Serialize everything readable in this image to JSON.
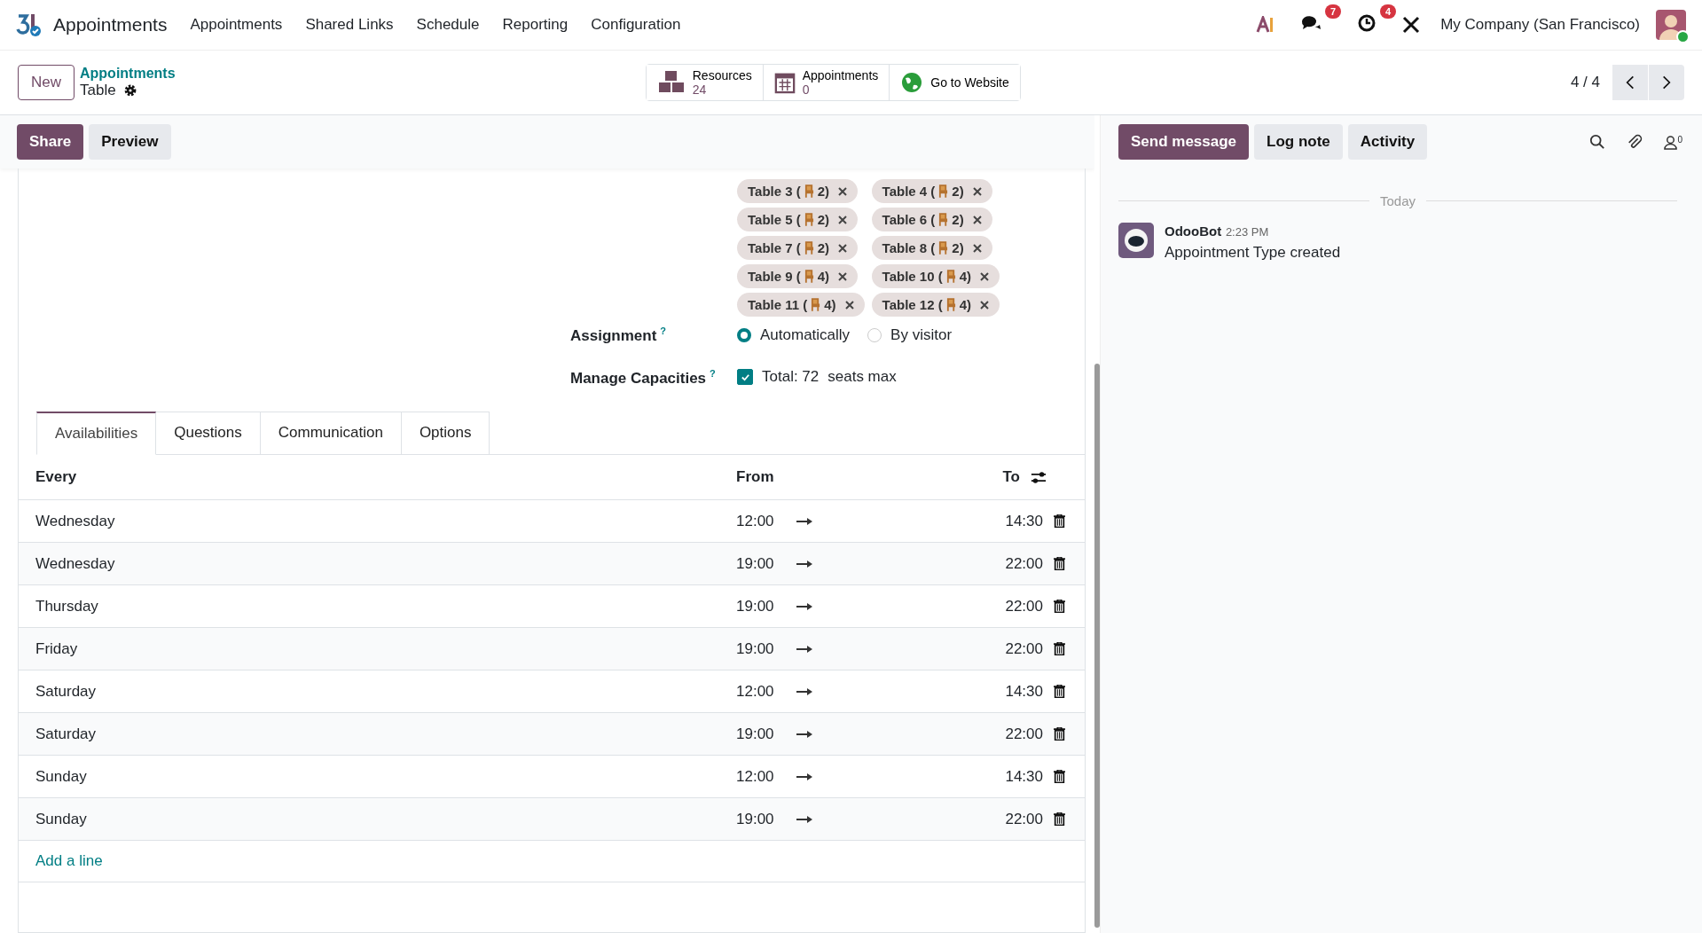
{
  "navbar": {
    "app_name": "Appointments",
    "menu": [
      "Appointments",
      "Shared Links",
      "Schedule",
      "Reporting",
      "Configuration"
    ],
    "chat_badge": "7",
    "activity_badge": "4",
    "company": "My Company (San Francisco)"
  },
  "control_panel": {
    "new_button": "New",
    "breadcrumb": "Appointments",
    "record_title": "Table",
    "smart_buttons": [
      {
        "kind": "resources",
        "label": "Resources",
        "value": "24"
      },
      {
        "kind": "calendar",
        "label": "Appointments",
        "value": "0"
      },
      {
        "kind": "website",
        "label": "Go to Website"
      }
    ],
    "pager": "4 / 4"
  },
  "form_actions": [
    {
      "label": "Share",
      "primary": true
    },
    {
      "label": "Preview",
      "primary": false
    }
  ],
  "resource_tags": [
    {
      "before": "Table 3 (",
      "after": "2)"
    },
    {
      "before": "Table 4 (",
      "after": "2)"
    },
    {
      "before": "Table 5 (",
      "after": "2)"
    },
    {
      "before": "Table 6 (",
      "after": "2)"
    },
    {
      "before": "Table 7 (",
      "after": "2)"
    },
    {
      "before": "Table 8 (",
      "after": "2)"
    },
    {
      "before": "Table 9 (",
      "after": "4)"
    },
    {
      "before": "Table 10 (",
      "after": "4)"
    },
    {
      "before": "Table 11 (",
      "after": "4)"
    },
    {
      "before": "Table 12 (",
      "after": "4)"
    }
  ],
  "assignment": {
    "label": "Assignment",
    "help": "?",
    "options": [
      {
        "label": "Automatically",
        "selected": true
      },
      {
        "label": "By visitor",
        "selected": false
      }
    ]
  },
  "capacities": {
    "label": "Manage Capacities",
    "help": "?",
    "checked": true,
    "total": "Total: 72",
    "unit": "seats max"
  },
  "tabs": [
    {
      "label": "Availabilities",
      "selected": true
    },
    {
      "label": "Questions",
      "selected": false
    },
    {
      "label": "Communication",
      "selected": false
    },
    {
      "label": "Options",
      "selected": false
    }
  ],
  "table": {
    "columns": [
      "Every",
      "From",
      "To"
    ],
    "rows": [
      {
        "day": "Wednesday",
        "from": "12:00",
        "to": "14:30"
      },
      {
        "day": "Wednesday",
        "from": "19:00",
        "to": "22:00"
      },
      {
        "day": "Thursday",
        "from": "19:00",
        "to": "22:00"
      },
      {
        "day": "Friday",
        "from": "19:00",
        "to": "22:00"
      },
      {
        "day": "Saturday",
        "from": "12:00",
        "to": "14:30"
      },
      {
        "day": "Saturday",
        "from": "19:00",
        "to": "22:00"
      },
      {
        "day": "Sunday",
        "from": "12:00",
        "to": "14:30"
      },
      {
        "day": "Sunday",
        "from": "19:00",
        "to": "22:00"
      }
    ],
    "add_line": "Add a line"
  },
  "chatter": {
    "buttons": [
      {
        "label": "Send message",
        "primary": true
      },
      {
        "label": "Log note",
        "primary": false
      },
      {
        "label": "Activity",
        "primary": false
      }
    ],
    "followers": "0",
    "separator": "Today",
    "messages": [
      {
        "author": "OdooBot",
        "time": "2:23 PM",
        "body": "Appointment Type created"
      }
    ]
  }
}
